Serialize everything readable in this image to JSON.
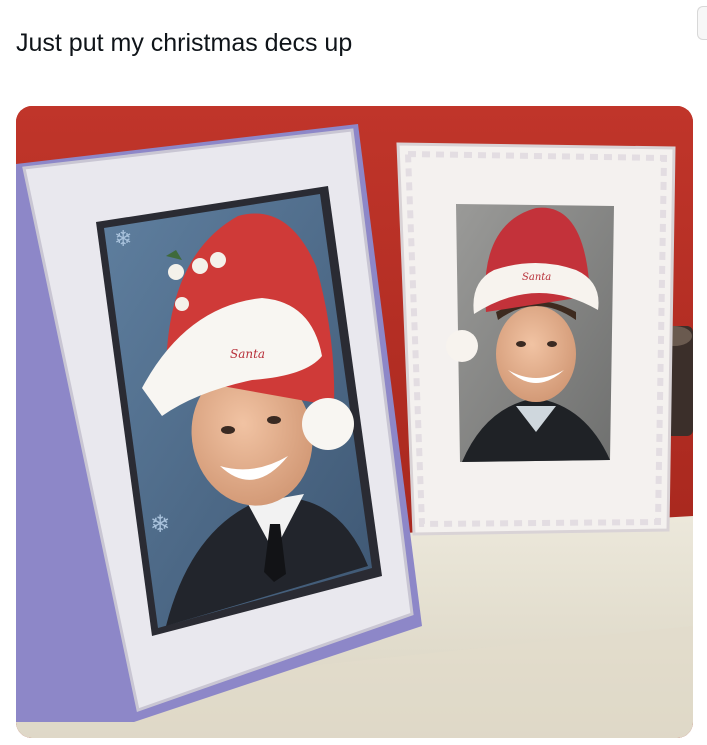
{
  "post": {
    "caption": "Just put my christmas decs up"
  },
  "photo": {
    "left_hat_text": "Santa",
    "right_hat_text": "Santa"
  },
  "colors": {
    "wall": "#b52a1f",
    "shelf": "#e6e1d2",
    "text": "#0f1419"
  }
}
